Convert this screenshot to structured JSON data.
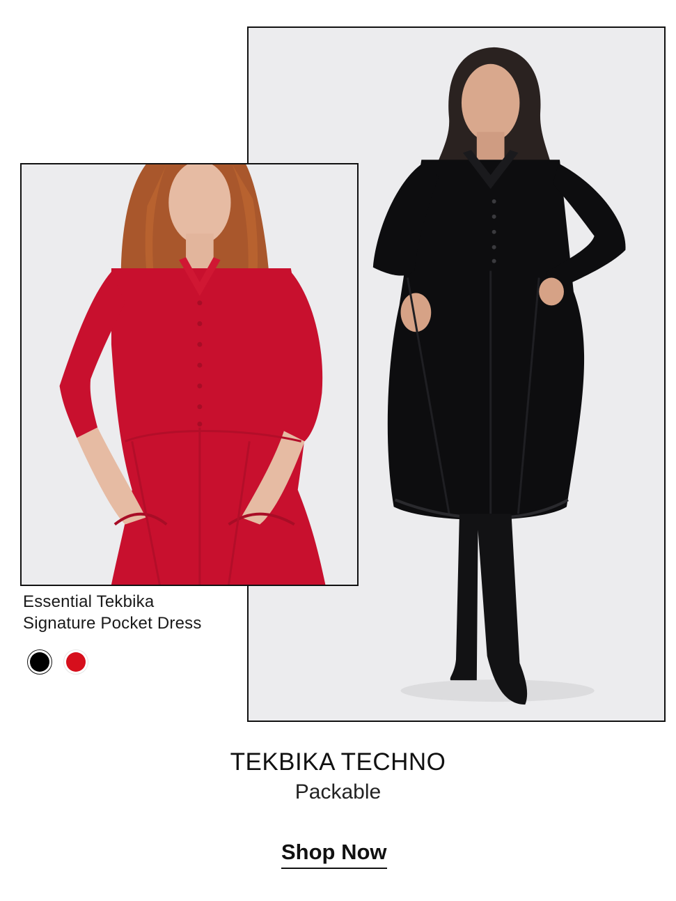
{
  "product": {
    "name_line1": "Essential Tekbika",
    "name_line2": "Signature Pocket Dress",
    "swatches": [
      {
        "name": "black",
        "color": "#000000"
      },
      {
        "name": "red",
        "color": "#d60f1c"
      }
    ]
  },
  "collection": {
    "title": "TEKBIKA TECHNO",
    "subtitle": "Packable"
  },
  "cta": {
    "label": "Shop Now"
  },
  "colors": {
    "frame_border": "#111111",
    "photo_background": "#ececee",
    "dress_red": "#c8102e",
    "dress_black": "#0d0d0f"
  }
}
